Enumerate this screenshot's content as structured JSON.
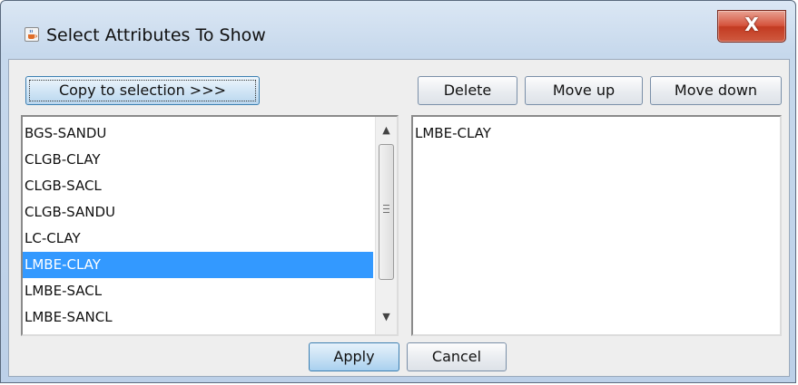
{
  "window": {
    "title": "Select Attributes To Show",
    "close_glyph": "X",
    "app_icon": "java-coffee-cup-icon",
    "close_icon": "close-icon"
  },
  "toolbar": {
    "copy_label": "Copy to selection >>>",
    "delete_label": "Delete",
    "move_up_label": "Move up",
    "move_down_label": "Move down"
  },
  "available_list": {
    "items": [
      "BGS-SANDU",
      "CLGB-CLAY",
      "CLGB-SACL",
      "CLGB-SANDU",
      "LC-CLAY",
      "LMBE-CLAY",
      "LMBE-SACL",
      "LMBE-SANCL"
    ],
    "selected_item": "LMBE-CLAY",
    "scroll_up_glyph": "▲",
    "scroll_down_glyph": "▼"
  },
  "selected_list": {
    "items": [
      "LMBE-CLAY"
    ]
  },
  "footer": {
    "apply_label": "Apply",
    "cancel_label": "Cancel"
  },
  "colors": {
    "selection": "#3399ff",
    "close_button": "#c33b22",
    "title_bar": "#c6d8ec"
  }
}
